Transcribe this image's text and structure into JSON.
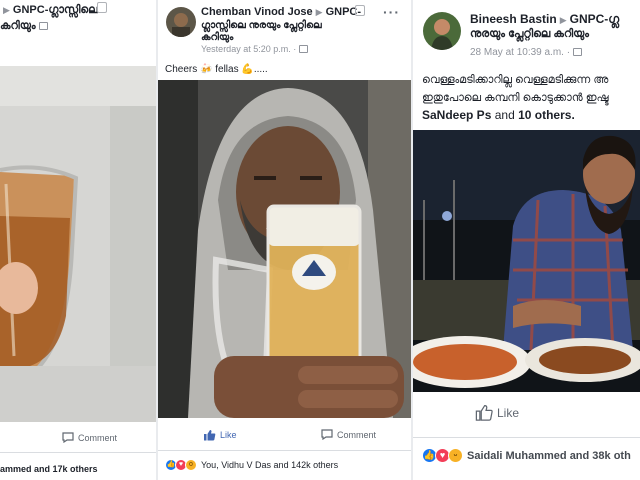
{
  "posts": [
    {
      "group_name": "GNPC-ഗ്ലാസ്സിലെ",
      "group_name_line2": "കറിയും",
      "actions": {
        "comment": "Comment"
      },
      "reaction_summary": "ammed and 17k others",
      "reactions": [
        "like-icon"
      ]
    },
    {
      "author": "Chemban Vinod Jose",
      "group_name": "GNPC-",
      "group_name_line2": "ഗ്ലാസ്സിലെ നുരയും പ്ലേറ്റിലെ",
      "group_name_line3": "കറിയും",
      "timestamp": "Yesterday at 5:20 p.m. ·",
      "text": "Cheers 🍻 fellas 💪.....",
      "actions": {
        "like": "Like",
        "comment": "Comment"
      },
      "reaction_summary": "You, Vidhu V Das and 142k others",
      "reactions": [
        "like-icon",
        "love-icon",
        "wow-icon"
      ]
    },
    {
      "author": "Bineesh Bastin",
      "group_name": "GNPC-ഗ്ല",
      "group_name_line2": "നുരയും പ്ലേറ്റിലെ കറിയും",
      "timestamp": "28 May at 10:39 a.m. ·",
      "text_line1": "വെള്ളംമടിക്കാറില്ല വെള്ളമടിക്കുന്ന അ",
      "text_line2": "ഇതുപോലെ കമ്പനി കൊടുക്കാൻ ഇഷ്ട",
      "tagged": "SaNdeep Ps",
      "tagged_connector": "and",
      "tagged_others": "10 others.",
      "actions": {
        "like": "Like"
      },
      "reaction_summary": "Saidali Muhammed and 38k oth",
      "reactions": [
        "like-icon",
        "love-icon",
        "haha-icon"
      ]
    }
  ],
  "colors": {
    "facebook_blue": "#4267b2",
    "like_blue": "#1877f2",
    "love_red": "#f33e58",
    "haha_yellow": "#f7b125"
  }
}
